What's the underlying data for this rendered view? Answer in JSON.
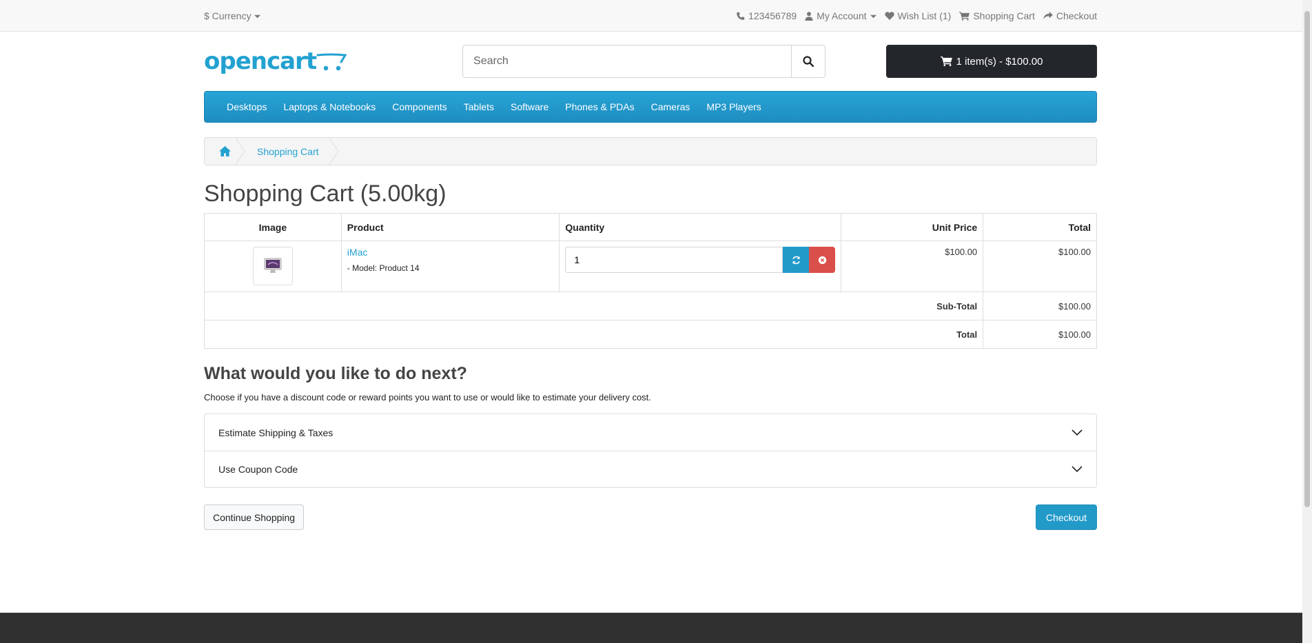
{
  "topbar": {
    "currency": "$ Currency",
    "phone": "123456789",
    "my_account": "My Account",
    "wishlist": "Wish List (1)",
    "shopping_cart": "Shopping Cart",
    "checkout": "Checkout"
  },
  "header": {
    "logo": "opencart",
    "search_placeholder": "Search",
    "cart_button": "1 item(s) - $100.00"
  },
  "menu": [
    "Desktops",
    "Laptops & Notebooks",
    "Components",
    "Tablets",
    "Software",
    "Phones & PDAs",
    "Cameras",
    "MP3 Players"
  ],
  "breadcrumb": {
    "current": "Shopping Cart"
  },
  "page_title": "Shopping Cart (5.00kg)",
  "cart_table": {
    "headers": {
      "image": "Image",
      "product": "Product",
      "quantity": "Quantity",
      "unit_price": "Unit Price",
      "total": "Total"
    },
    "rows": [
      {
        "product": "iMac",
        "model": "- Model: Product 14",
        "quantity": "1",
        "unit_price": "$100.00",
        "total": "$100.00"
      }
    ],
    "subtotal_label": "Sub-Total",
    "subtotal_value": "$100.00",
    "total_label": "Total",
    "total_value": "$100.00"
  },
  "next": {
    "heading": "What would you like to do next?",
    "intro": "Choose if you have a discount code or reward points you want to use or would like to estimate your delivery cost.",
    "accordion": [
      "Estimate Shipping & Taxes",
      "Use Coupon Code"
    ]
  },
  "buttons": {
    "continue": "Continue Shopping",
    "checkout": "Checkout"
  },
  "colors": {
    "accent": "#23a1d1",
    "dark": "#23272b",
    "danger": "#da4f49"
  }
}
